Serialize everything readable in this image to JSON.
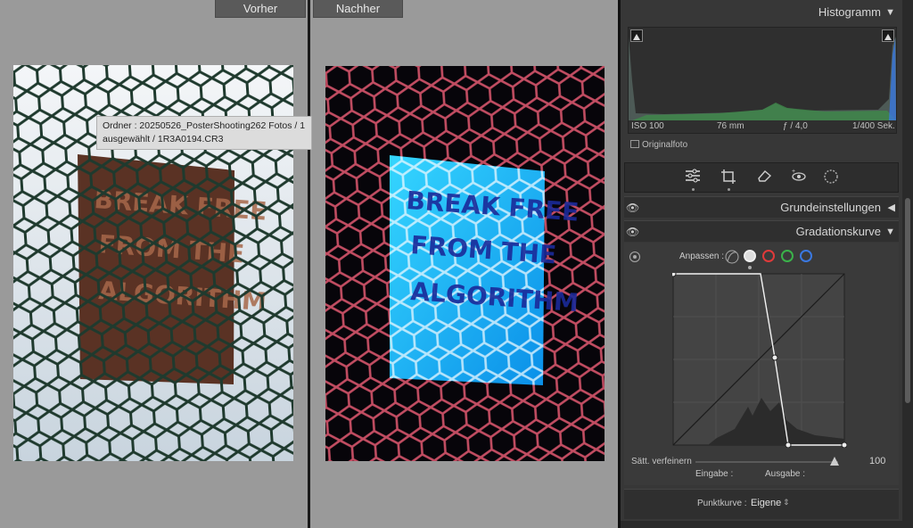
{
  "compare": {
    "before_label": "Vorher",
    "after_label": "Nachher"
  },
  "tooltip": {
    "line1": "Ordner : 20250526_PosterShooting262 Fotos / 1",
    "line2": "ausgewählt / 1R3A0194.CR3"
  },
  "poster": {
    "line1": "BREAK FREE",
    "line2": "FROM THE",
    "line3": "ALGORITHM"
  },
  "histogram": {
    "title": "Histogramm",
    "iso": "ISO 100",
    "focal": "76 mm",
    "aperture": "ƒ / 4,0",
    "shutter": "1/400 Sek.",
    "original_photo": "Originalfoto"
  },
  "tools": [
    "sliders-icon",
    "crop-icon",
    "eraser-icon",
    "redeye-icon",
    "masking-icon"
  ],
  "sections": {
    "basic": "Grundeinstellungen",
    "curve": "Gradationskurve"
  },
  "curve": {
    "adjust_label": "Anpassen :",
    "refine_label": "Sätt. verfeinern",
    "refine_value": "100",
    "input_label": "Eingabe :",
    "output_label": "Ausgabe :",
    "point_curve_label": "Punktkurve :",
    "point_curve_value": "Eigene",
    "channel_colors": [
      "#cccccc",
      "#e03a3a",
      "#3ab24a",
      "#3a78e0"
    ]
  }
}
